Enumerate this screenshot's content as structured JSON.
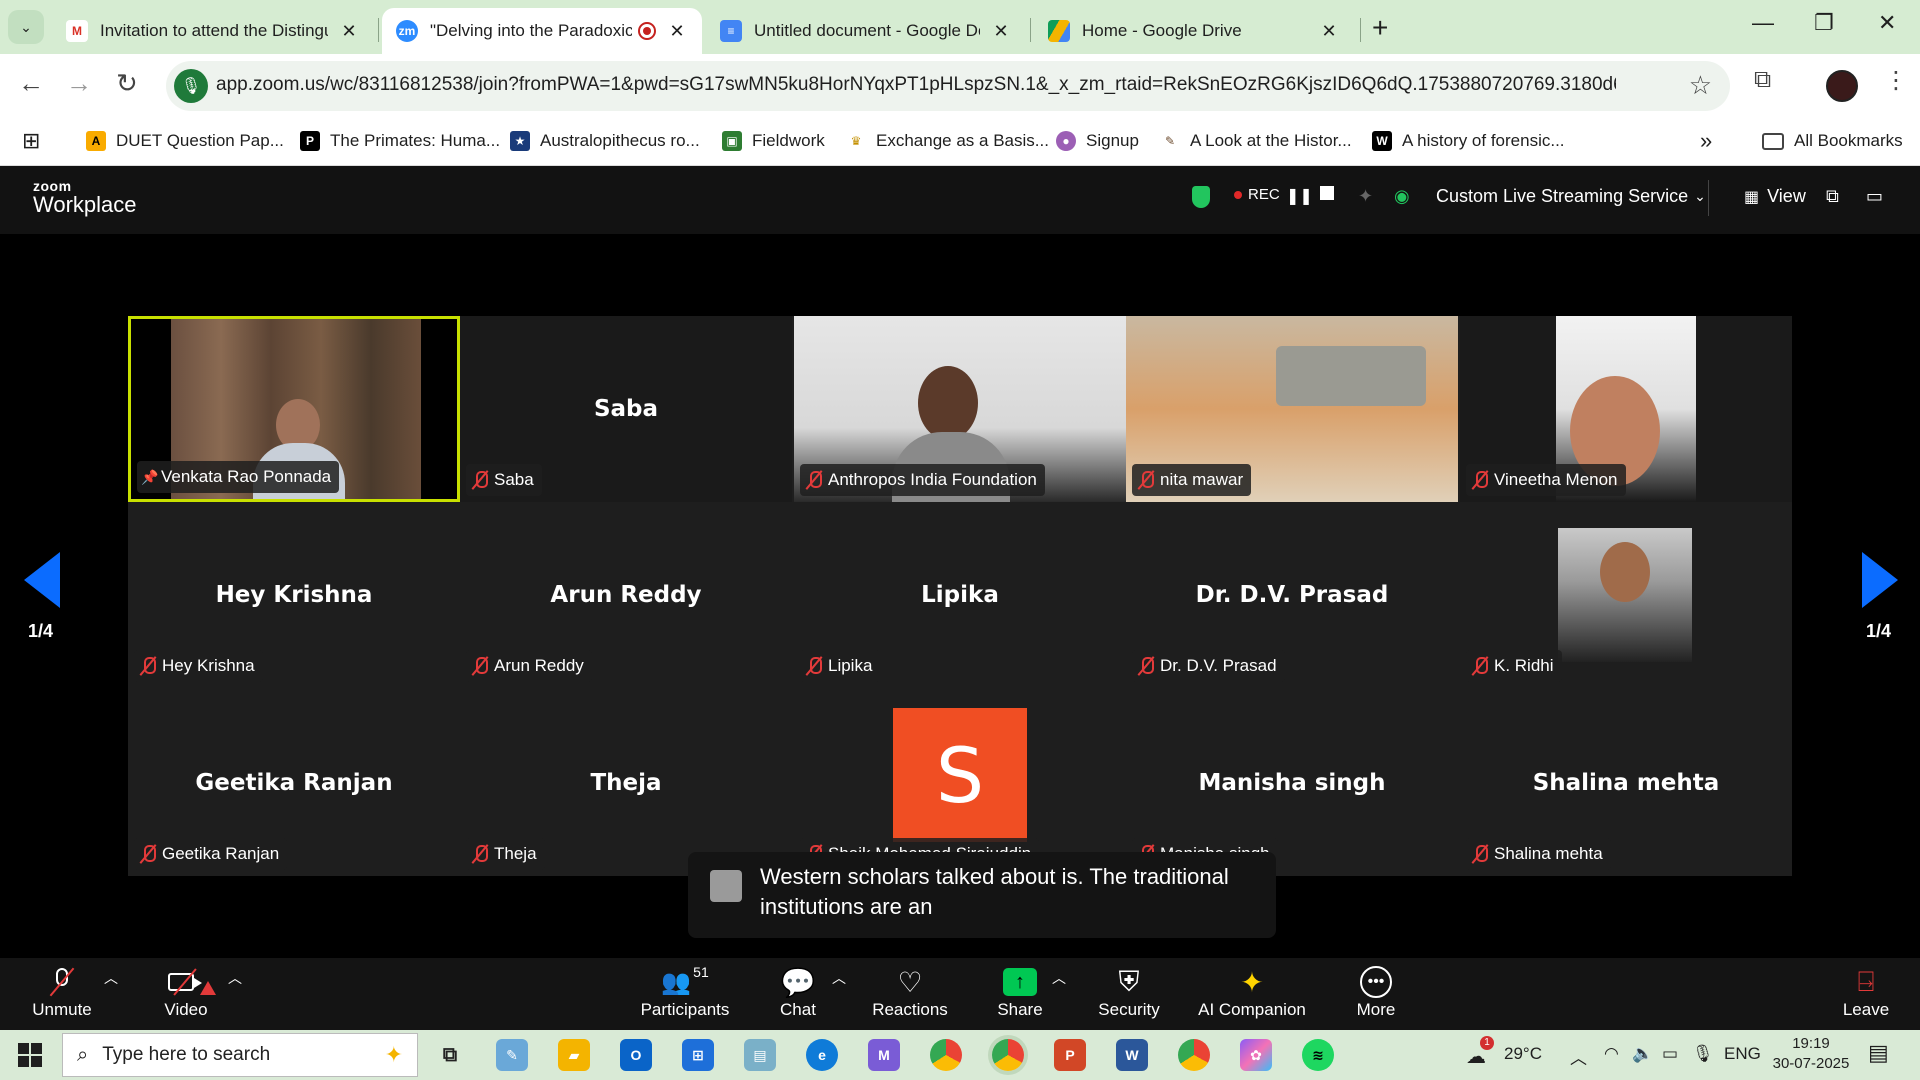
{
  "browser": {
    "tabs": [
      {
        "title": "Invitation to attend the Distingu",
        "favicon": "gmail-icon"
      },
      {
        "title": "\"Delving into the Paradoxic",
        "favicon": "zoom-icon",
        "recording": true
      },
      {
        "title": "Untitled document - Google Do",
        "favicon": "docs-icon"
      },
      {
        "title": "Home - Google Drive",
        "favicon": "drive-icon"
      }
    ],
    "url": "app.zoom.us/wc/83116812538/join?fromPWA=1&pwd=sG17swMN5ku8HorNYqxPT1pHLspzSN.1&_x_zm_rtaid=RekSnEOzRG6KjszID6Q6dQ.1753880720769.3180d6aeb53...",
    "bookmarks": [
      "DUET Question Pap...",
      "The Primates: Huma...",
      "Australopithecus ro...",
      "Fieldwork",
      "Exchange as a Basis...",
      "Signup",
      "A Look at the Histor...",
      "A history of forensic..."
    ],
    "all_bookmarks": "All Bookmarks",
    "more_bookmarks": "»"
  },
  "zoom": {
    "logo_small": "zoom",
    "logo_big": "Workplace",
    "rec_label": "REC",
    "streaming_label": "Custom Live Streaming Service",
    "view_label": "View",
    "page_left": "1/4",
    "page_right": "1/4",
    "participants": [
      {
        "name": "Venkata Rao Ponnada",
        "pinned": true,
        "video": true,
        "active_speaker": true
      },
      {
        "name": "Saba",
        "video": false
      },
      {
        "name": "Anthropos India Foundation",
        "video": true
      },
      {
        "name": "nita mawar",
        "video": true
      },
      {
        "name": "Vineetha Menon",
        "video": true
      },
      {
        "name": "Hey Krishna",
        "video": false
      },
      {
        "name": "Arun Reddy",
        "video": false
      },
      {
        "name": "Lipika",
        "video": false
      },
      {
        "name": "Dr. D.V. Prasad",
        "video": false
      },
      {
        "name": "K. Ridhi",
        "video": true
      },
      {
        "name": "Geetika Ranjan",
        "video": false
      },
      {
        "name": "Theja",
        "video": false
      },
      {
        "name": "Shaik Mohamed Sirajuddin",
        "video": false,
        "avatar_letter": "S"
      },
      {
        "name": "Manisha singh",
        "video": false
      },
      {
        "name": "Shalina mehta",
        "video": false
      }
    ],
    "caption_text": "Western scholars talked about is. The traditional institutions are an",
    "controls": {
      "unmute": "Unmute",
      "video": "Video",
      "participants": "Participants",
      "participants_count": "51",
      "chat": "Chat",
      "reactions": "Reactions",
      "share": "Share",
      "security": "Security",
      "ai_companion": "AI Companion",
      "more": "More",
      "leave": "Leave"
    }
  },
  "taskbar": {
    "search_placeholder": "Type here to search",
    "weather": "29°C",
    "weather_badge": "1",
    "language": "ENG",
    "time": "19:19",
    "date": "30-07-2025"
  },
  "colors": {
    "zoom_blue": "#0b6cff",
    "mute_red": "#e23a3a",
    "share_green": "#00c853",
    "avatar_orange": "#f04e23",
    "active_speaker_border": "#c8e000"
  }
}
